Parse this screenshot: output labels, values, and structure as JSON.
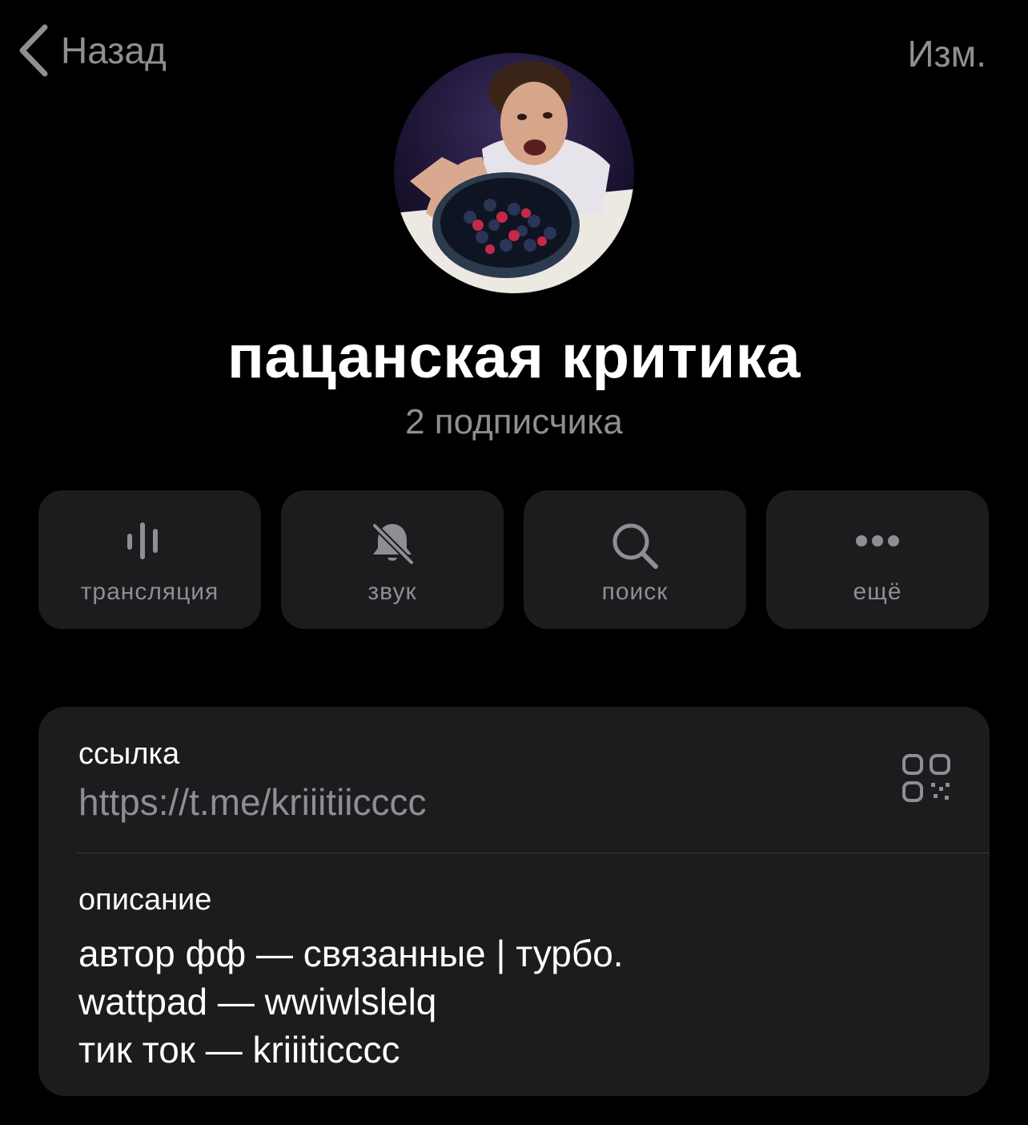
{
  "nav": {
    "back_label": "Назад",
    "edit_label": "Изм."
  },
  "channel": {
    "title": "пацанская критика",
    "subscribers": "2 подписчика"
  },
  "actions": [
    {
      "label": "трансляция",
      "icon": "live-stream-icon"
    },
    {
      "label": "звук",
      "icon": "bell-slash-icon"
    },
    {
      "label": "поиск",
      "icon": "search-icon"
    },
    {
      "label": "ещё",
      "icon": "more-dots-icon"
    }
  ],
  "info": {
    "link_title": "ссылка",
    "link_value": "https://t.me/kriiitiicccc",
    "description_title": "описание",
    "description_lines": [
      "автор фф — связанные | турбо.",
      "wattpad — wwiwlslelq",
      "тик ток — kriiiticccc"
    ]
  },
  "colors": {
    "background": "#000000",
    "card": "#1c1c1e",
    "secondary_text": "#8e8e93",
    "primary_text": "#ffffff",
    "divider": "#38383a"
  }
}
